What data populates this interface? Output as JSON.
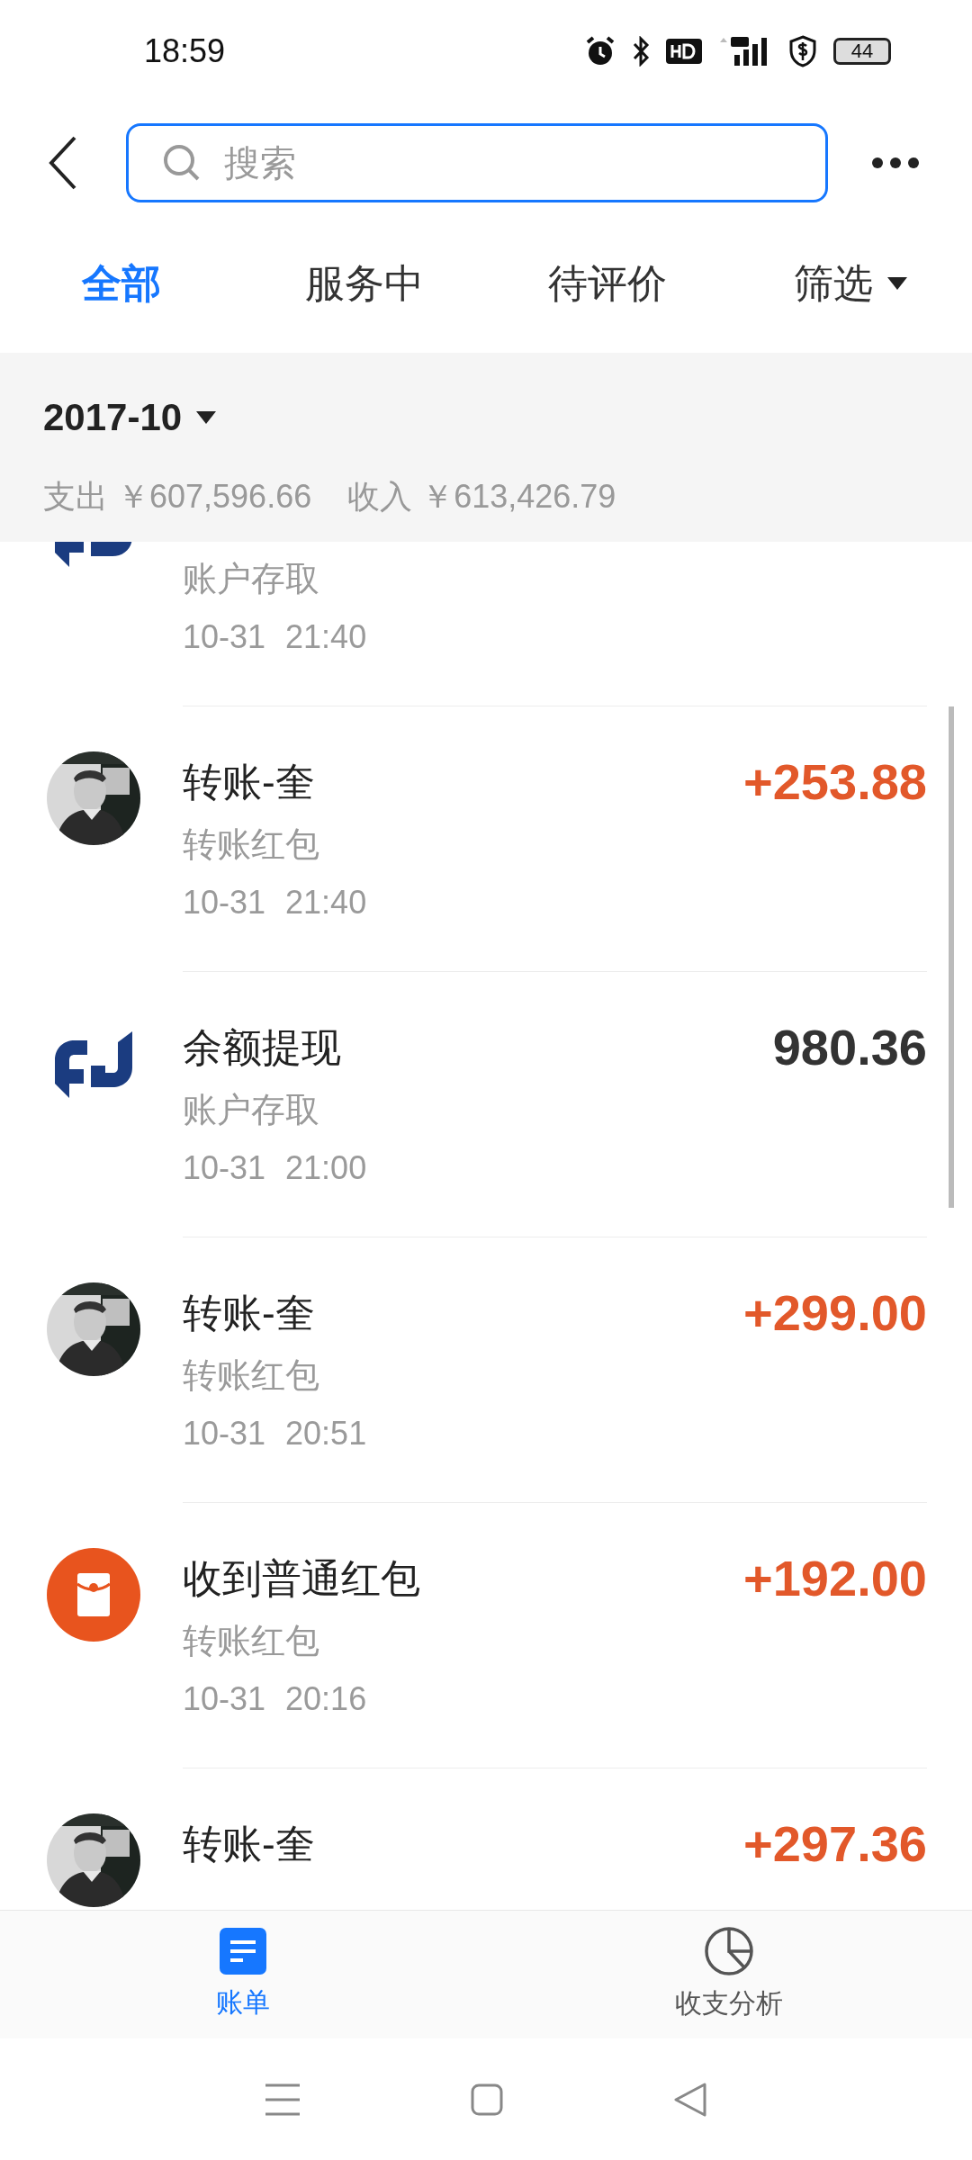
{
  "status_bar": {
    "time": "18:59",
    "battery": "44"
  },
  "search": {
    "placeholder": "搜索"
  },
  "tabs": [
    {
      "label": "全部",
      "selected": true,
      "kind": "tab"
    },
    {
      "label": "服务中",
      "selected": false,
      "kind": "tab"
    },
    {
      "label": "待评价",
      "selected": false,
      "kind": "tab"
    },
    {
      "label": "筛选",
      "selected": false,
      "kind": "dropdown"
    }
  ],
  "summary": {
    "month": "2017-10",
    "expense": "支出 ￥607,596.66",
    "income": "收入 ￥613,426.79"
  },
  "records": [
    {
      "kind": "bank",
      "subtitle": "账户存取",
      "date": "10-31",
      "time": "21:40"
    },
    {
      "kind": "avatar",
      "title": "转账-奎",
      "amount": "+253.88",
      "income": true,
      "subtitle": "转账红包",
      "date": "10-31",
      "time": "21:40"
    },
    {
      "kind": "bank",
      "title": "余额提现",
      "amount": "980.36",
      "income": false,
      "subtitle": "账户存取",
      "date": "10-31",
      "time": "21:00"
    },
    {
      "kind": "avatar",
      "title": "转账-奎",
      "amount": "+299.00",
      "income": true,
      "subtitle": "转账红包",
      "date": "10-31",
      "time": "20:51"
    },
    {
      "kind": "red_packet",
      "title": "收到普通红包",
      "amount": "+192.00",
      "income": true,
      "subtitle": "转账红包",
      "date": "10-31",
      "time": "20:16"
    },
    {
      "kind": "avatar",
      "title": "转账-奎",
      "amount": "+297.36",
      "income": true
    }
  ],
  "bottom_nav": [
    {
      "label": "账单",
      "selected": true,
      "kind": "bills"
    },
    {
      "label": "收支分析",
      "selected": false,
      "kind": "analysis"
    }
  ]
}
